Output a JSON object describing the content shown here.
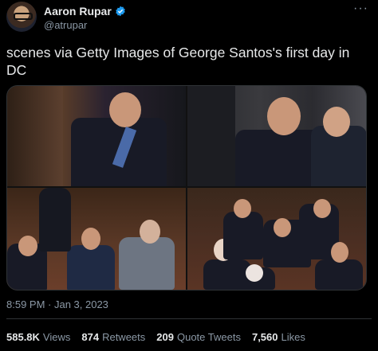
{
  "author": {
    "name": "Aaron Rupar",
    "handle": "@atrupar",
    "verified_icon": "verified-badge-icon",
    "verified_color": "#1d9bf0"
  },
  "more_icon": "ellipsis-icon",
  "tweet": {
    "text": "scenes via Getty Images of George Santos's first day in DC"
  },
  "media": {
    "photos": [
      "photo-1",
      "photo-2",
      "photo-3",
      "photo-4"
    ]
  },
  "timestamp": "8:59 PM · Jan 3, 2023",
  "stats": {
    "views_count": "585.8K",
    "views_label": "Views",
    "retweets_count": "874",
    "retweets_label": "Retweets",
    "quotes_count": "209",
    "quotes_label": "Quote Tweets",
    "likes_count": "7,560",
    "likes_label": "Likes"
  }
}
